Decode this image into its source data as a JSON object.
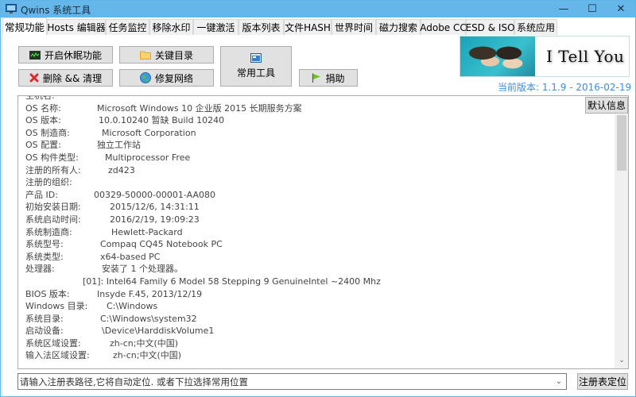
{
  "window": {
    "title": "Qwins 系统工具",
    "controls": {
      "minimize": "—",
      "maximize": "☐",
      "close": "✕"
    }
  },
  "tabs": [
    {
      "label": "常规功能",
      "active": true
    },
    {
      "label": "Hosts 编辑器"
    },
    {
      "label": "任务监控"
    },
    {
      "label": "移除水印"
    },
    {
      "label": "一键激活"
    },
    {
      "label": "版本列表"
    },
    {
      "label": "文件HASH"
    },
    {
      "label": "世界时间"
    },
    {
      "label": "磁力搜索"
    },
    {
      "label": "Adobe CC"
    },
    {
      "label": "ESD & ISO"
    },
    {
      "label": "系统应用"
    }
  ],
  "buttons": {
    "hibernate": {
      "label": "开启休眠功能",
      "icon": "monitor-icon"
    },
    "delete_clean": {
      "label": "删除 && 清理",
      "icon": "red-x-icon"
    },
    "key_dirs": {
      "label": "关键目录",
      "icon": "folder-icon"
    },
    "repair_network": {
      "label": "修复网络",
      "icon": "globe-icon"
    },
    "common_tools": {
      "label": "常用工具",
      "icon": "window-icon"
    },
    "donate": {
      "label": "捐助",
      "icon": "flag-icon"
    }
  },
  "banner": {
    "text": "I Tell You",
    "version": "当前版本: 1.1.9 - 2016-02-19"
  },
  "info": {
    "default_button": "默认信息",
    "lines": [
      {
        "key": "主机名:",
        "value": ""
      },
      {
        "key": "OS 名称:",
        "value": "Microsoft Windows 10 企业版 2015 长期服务方案"
      },
      {
        "key": "OS 版本:",
        "value": "10.0.10240 暂缺 Build 10240"
      },
      {
        "key": "OS 制造商:",
        "value": "Microsoft Corporation"
      },
      {
        "key": "OS 配置:",
        "value": "独立工作站"
      },
      {
        "key": "OS 构件类型:",
        "value": "Multiprocessor Free"
      },
      {
        "key": "注册的所有人:",
        "value": "zd423"
      },
      {
        "key": "注册的组织:",
        "value": ""
      },
      {
        "key": "产品 ID:",
        "value": "00329-50000-00001-AA080"
      },
      {
        "key": "初始安装日期:",
        "value": "2015/12/6, 14:31:11"
      },
      {
        "key": "系统启动时间:",
        "value": "2016/2/19, 19:09:23"
      },
      {
        "key": "系统制造商:",
        "value": "Hewlett-Packard"
      },
      {
        "key": "系统型号:",
        "value": "Compaq CQ45 Notebook PC"
      },
      {
        "key": "系统类型:",
        "value": "x64-based PC"
      },
      {
        "key": "处理器:",
        "value": "安装了 1 个处理器。"
      },
      {
        "key": "",
        "value": "[01]: Intel64 Family 6 Model 58 Stepping 9 GenuineIntel ~2400 Mhz"
      },
      {
        "key": "BIOS 版本:",
        "value": "Insyde F.45, 2013/12/19"
      },
      {
        "key": "Windows 目录:",
        "value": "C:\\Windows"
      },
      {
        "key": "系统目录:",
        "value": "C:\\Windows\\system32"
      },
      {
        "key": "启动设备:",
        "value": "\\Device\\HarddiskVolume1"
      },
      {
        "key": "系统区域设置:",
        "value": "zh-cn;中文(中国)"
      },
      {
        "key": "输入法区域设置:",
        "value": "zh-cn;中文(中国)"
      }
    ]
  },
  "registry": {
    "placeholder": "请输入注册表路径,它将自动定位. 或者下拉选择常用位置",
    "value": "请输入注册表路径,它将自动定位. 或者下拉选择常用位置",
    "locate_button": "注册表定位"
  }
}
